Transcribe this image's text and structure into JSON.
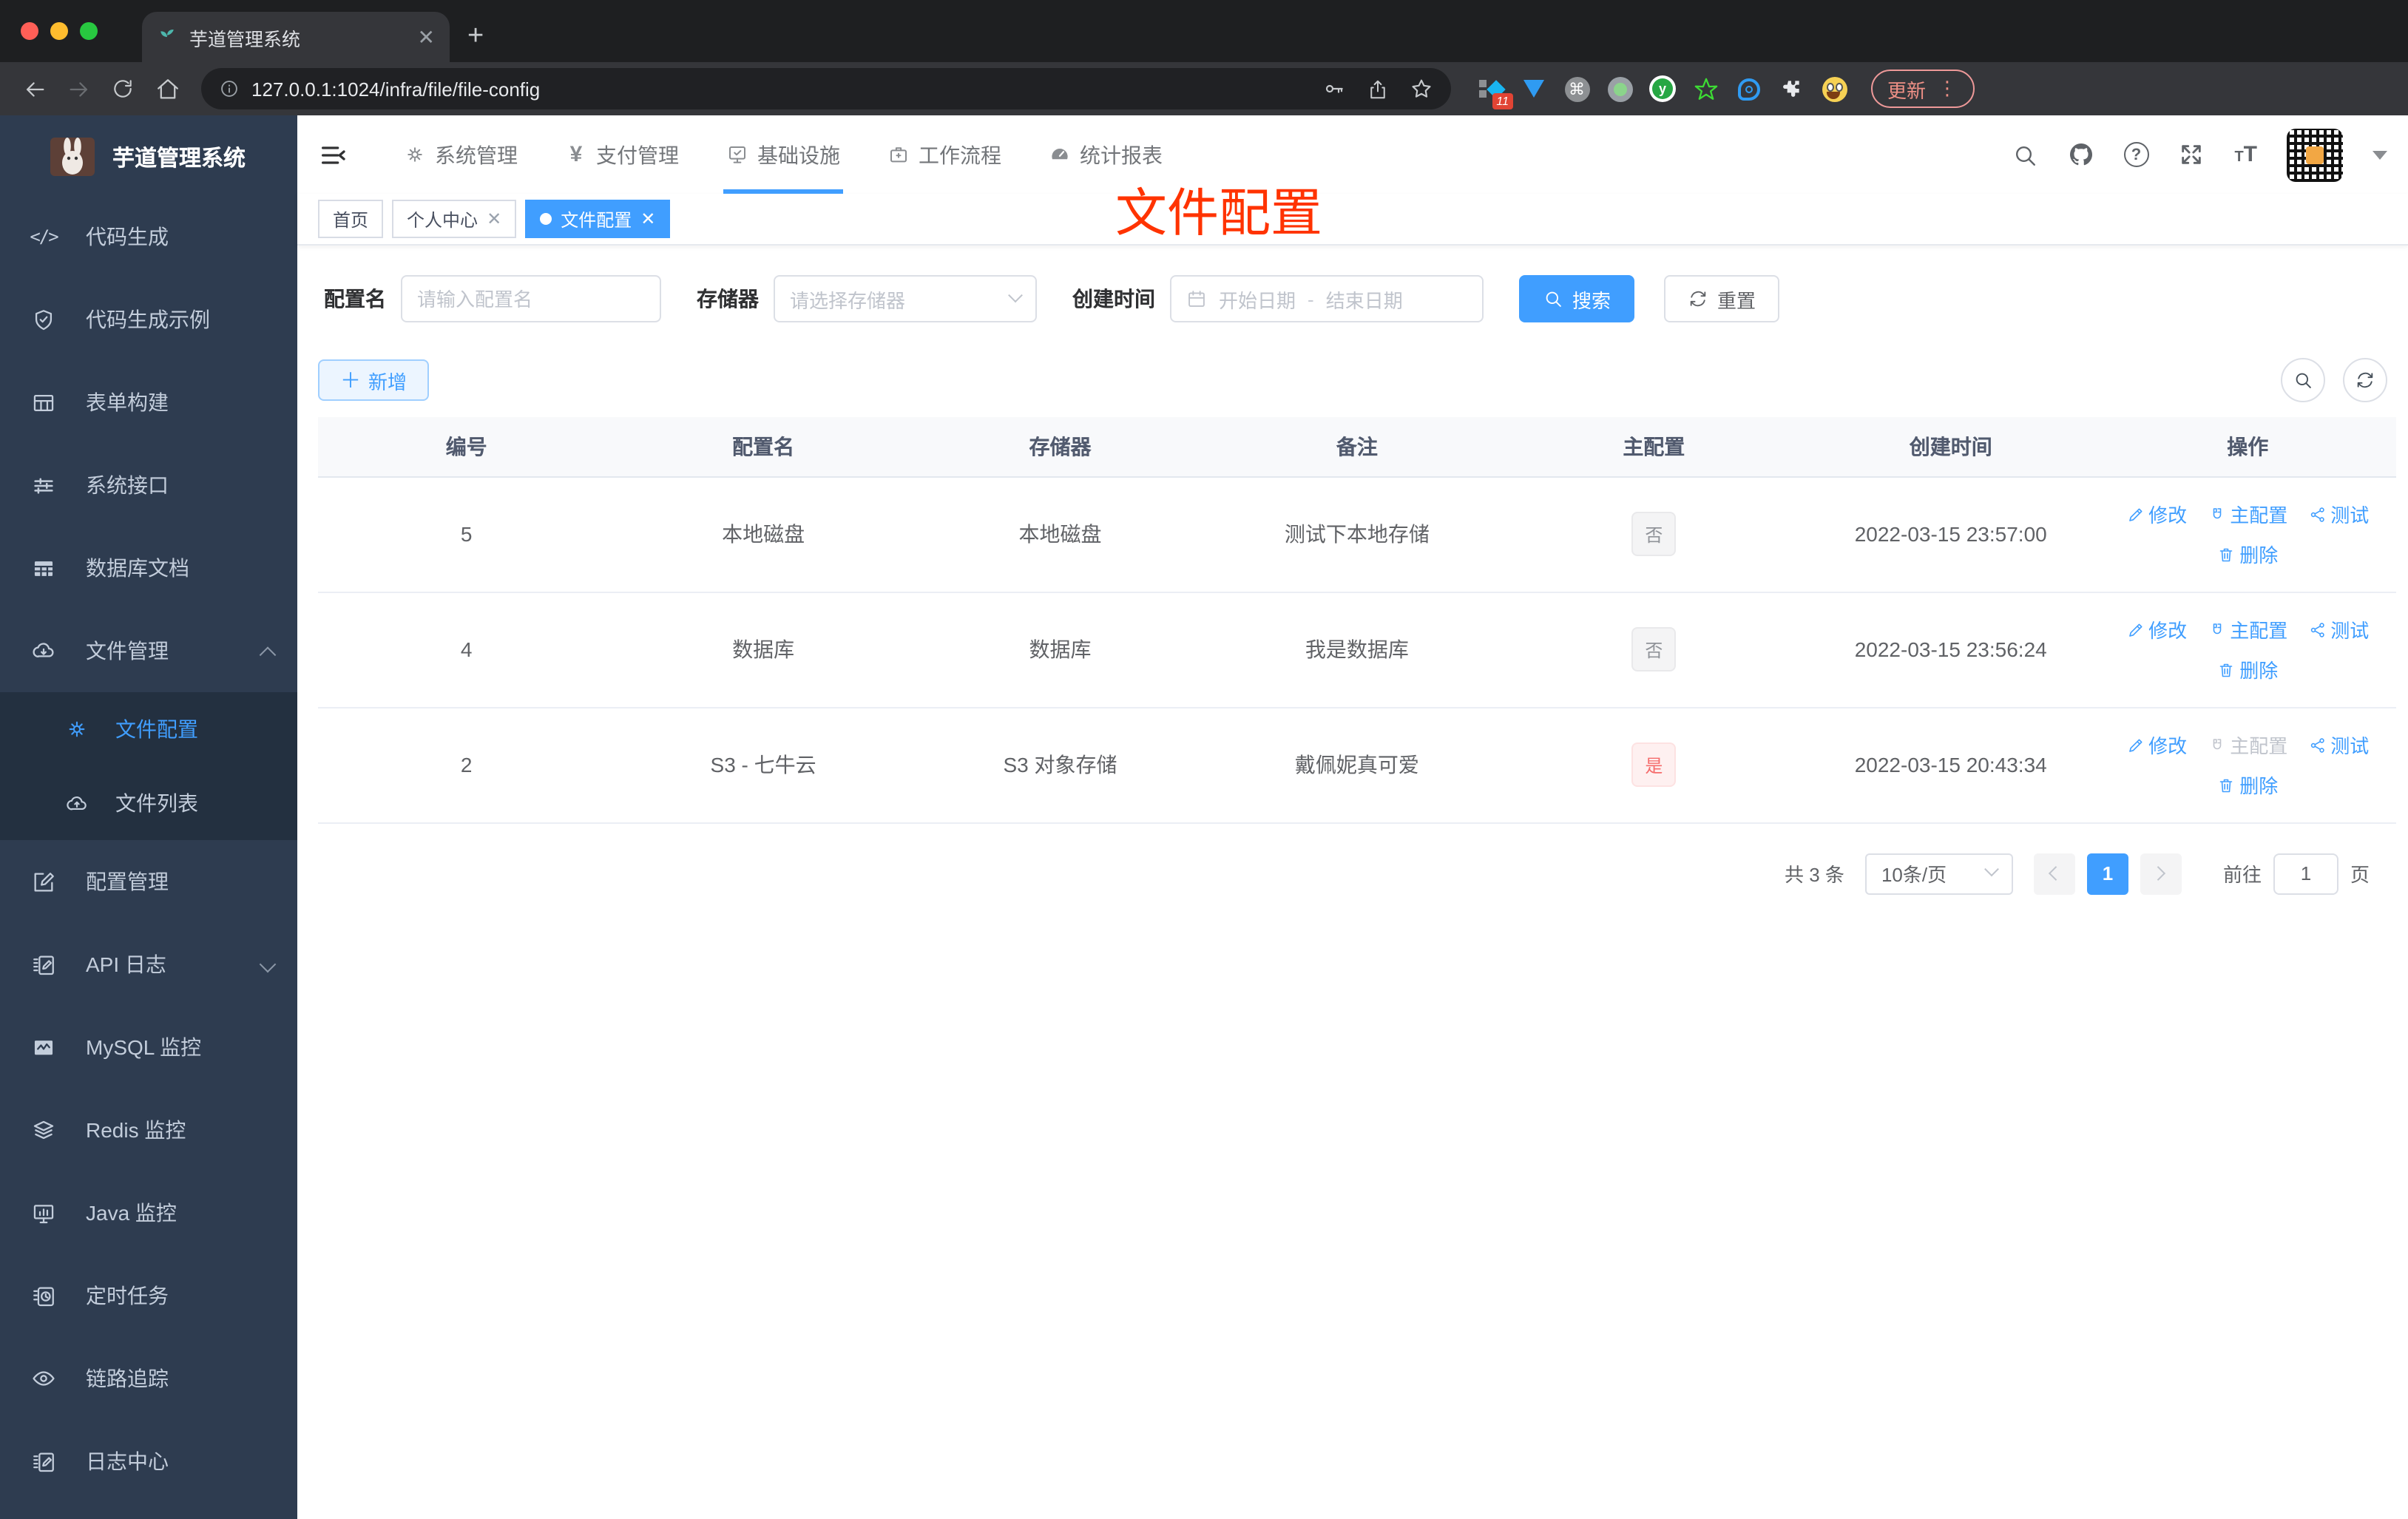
{
  "browser": {
    "tab_title": "芋道管理系统",
    "url": "127.0.0.1:1024/infra/file/file-config",
    "ext_badge": "11",
    "update_label": "更新"
  },
  "annotation": {
    "text": "文件配置",
    "color": "#ff3300"
  },
  "app": {
    "logo_title": "芋道管理系统",
    "top_nav": [
      "系统管理",
      "支付管理",
      "基础设施",
      "工作流程",
      "统计报表"
    ],
    "sidebar": [
      "代码生成",
      "代码生成示例",
      "表单构建",
      "系统接口",
      "数据库文档",
      "文件管理",
      "文件配置",
      "文件列表",
      "配置管理",
      "API 日志",
      "MySQL 监控",
      "Redis 监控",
      "Java 监控",
      "定时任务",
      "链路追踪",
      "日志中心"
    ],
    "tags": [
      "首页",
      "个人中心",
      "文件配置"
    ],
    "filters": {
      "name_label": "配置名",
      "name_placeholder": "请输入配置名",
      "storage_label": "存储器",
      "storage_placeholder": "请选择存储器",
      "created_label": "创建时间",
      "date_start": "开始日期",
      "date_separator": "-",
      "date_end": "结束日期",
      "search_label": "搜索",
      "reset_label": "重置"
    },
    "toolbar": {
      "add_label": "新增"
    },
    "table": {
      "headers": [
        "编号",
        "配置名",
        "存储器",
        "备注",
        "主配置",
        "创建时间",
        "操作"
      ],
      "action_labels": {
        "edit": "修改",
        "master": "主配置",
        "test": "测试",
        "delete": "删除"
      },
      "rows": [
        {
          "id": "5",
          "name": "本地磁盘",
          "storage": "本地磁盘",
          "remark": "测试下本地存储",
          "master": "否",
          "created": "2022-03-15 23:57:00"
        },
        {
          "id": "4",
          "name": "数据库",
          "storage": "数据库",
          "remark": "我是数据库",
          "master": "否",
          "created": "2022-03-15 23:56:24"
        },
        {
          "id": "2",
          "name": "S3 - 七牛云",
          "storage": "S3 对象存储",
          "remark": "戴佩妮真可爱",
          "master": "是",
          "created": "2022-03-15 20:43:34"
        }
      ]
    },
    "pagination": {
      "total": "共 3 条",
      "page_size": "10条/页",
      "current_page": "1",
      "goto_label": "前往",
      "goto_value": "1",
      "page_unit": "页"
    },
    "colors": {
      "accent": "#409eff",
      "danger": "#f56c6c"
    }
  }
}
